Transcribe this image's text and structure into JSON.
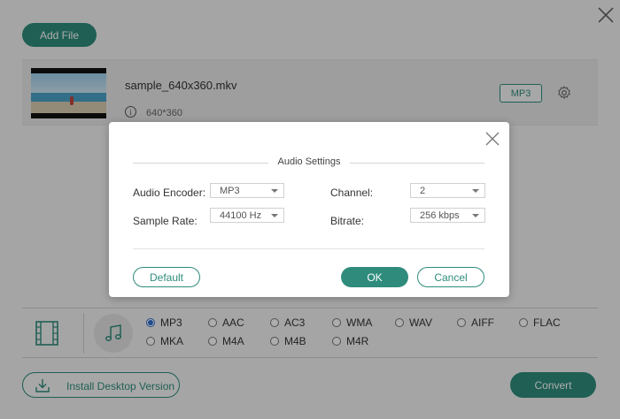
{
  "toolbar": {
    "add_file_label": "Add File"
  },
  "file": {
    "name": "sample_640x360.mkv",
    "resolution": "640*360",
    "format_badge": "MP3"
  },
  "formats": {
    "row1": [
      "MP3",
      "AAC",
      "AC3",
      "WMA",
      "WAV",
      "AIFF",
      "FLAC"
    ],
    "row2": [
      "MKA",
      "M4A",
      "M4B",
      "M4R"
    ],
    "selected": "MP3"
  },
  "footer": {
    "install_label": "Install Desktop Version",
    "convert_label": "Convert"
  },
  "dialog": {
    "title": "Audio Settings",
    "encoder_label": "Audio Encoder:",
    "encoder_value": "MP3",
    "channel_label": "Channel:",
    "channel_value": "2",
    "sample_rate_label": "Sample Rate:",
    "sample_rate_value": "44100 Hz",
    "bitrate_label": "Bitrate:",
    "bitrate_value": "256 kbps",
    "default_label": "Default",
    "ok_label": "OK",
    "cancel_label": "Cancel"
  },
  "colors": {
    "accent": "#2f8c7c",
    "radio_selected": "#2f6ed1"
  },
  "icons": [
    "close-icon",
    "info-icon",
    "gear-icon",
    "film-icon",
    "music-note-icon",
    "download-icon",
    "chevron-down-icon"
  ]
}
